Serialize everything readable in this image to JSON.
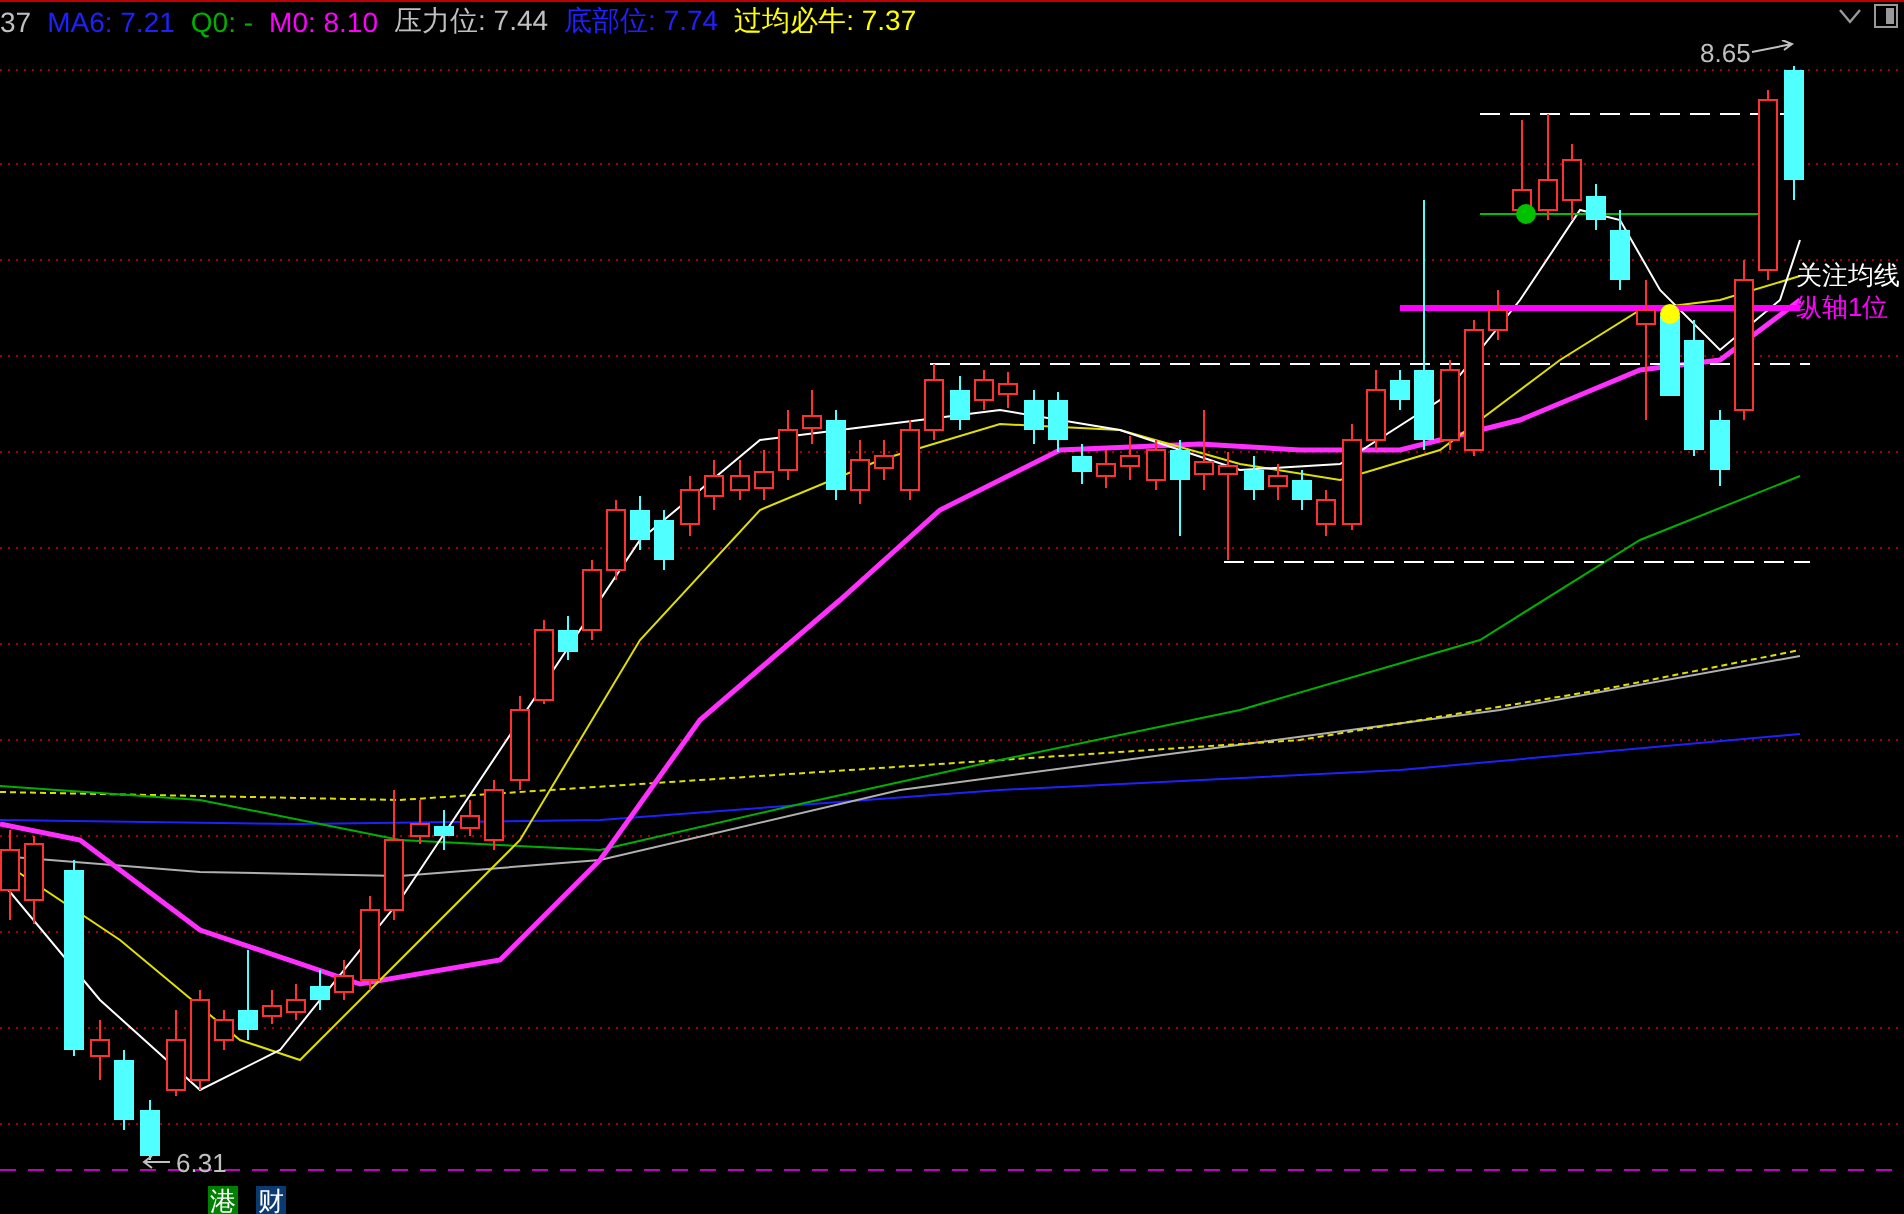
{
  "legend": [
    {
      "label": "37",
      "color": "#c0c0c0"
    },
    {
      "label": "MA6: 7.21",
      "color": "#2020ff"
    },
    {
      "label": "Q0: -",
      "color": "#00b000"
    },
    {
      "label": "M0: 8.10",
      "color": "#ff00ff"
    },
    {
      "label": "压力位: 7.44",
      "color": "#c0c0c0"
    },
    {
      "label": "底部位: 7.74",
      "color": "#2020ff"
    },
    {
      "label": "过均必牛: 7.37",
      "color": "#ffff00"
    }
  ],
  "chart": {
    "high_label": "8.65",
    "low_label": "6.31",
    "annotations": [
      {
        "text": "关注均线",
        "color": "#ffffff"
      },
      {
        "text": "纵轴1位",
        "color": "#ff00ff"
      }
    ]
  },
  "badges": [
    {
      "text": "港",
      "color": "#008000"
    },
    {
      "text": "财",
      "color": "#0a3a70"
    }
  ]
}
